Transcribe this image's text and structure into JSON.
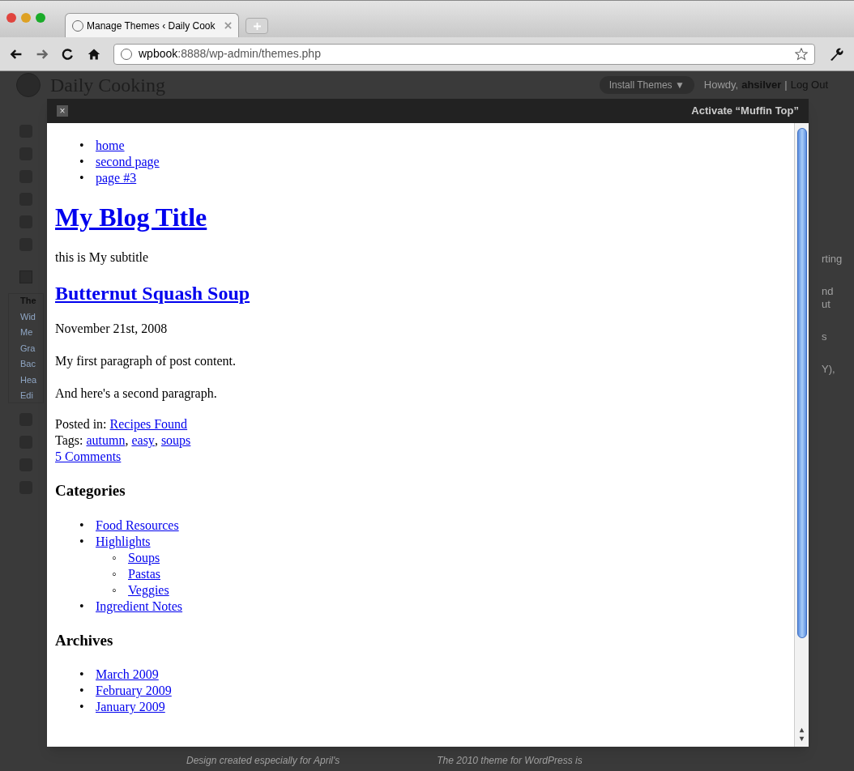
{
  "browser": {
    "tab_title": "Manage Themes ‹ Daily Cook",
    "url_host": "wpbook",
    "url_rest": ":8888/wp-admin/themes.php"
  },
  "admin": {
    "site_title": "Daily Cooking",
    "install_button": "Install Themes ▼",
    "howdy": "Howdy,",
    "user": "ahsilver",
    "separator": "|",
    "logout": "Log Out",
    "submenu": [
      {
        "label": "The",
        "selected": true
      },
      {
        "label": "Wid",
        "selected": false
      },
      {
        "label": "Me",
        "selected": false
      },
      {
        "label": "Gra",
        "selected": false
      },
      {
        "label": "Bac",
        "selected": false
      },
      {
        "label": "Hea",
        "selected": false
      },
      {
        "label": "Edi",
        "selected": false
      }
    ],
    "right_fragments": [
      "rting",
      "nd\nut",
      "s",
      "Y),"
    ],
    "bottom_descriptions": [
      "Design created especially for April's",
      "The 2010 theme for WordPress is"
    ]
  },
  "modal": {
    "title": "Activate “Muffin Top”",
    "close": "×",
    "bullet": "•",
    "sub_bullet": "◦",
    "tag_separator": ",",
    "nav": [
      "home",
      "second page",
      "page #3"
    ],
    "blog_title": "My Blog Title",
    "subtitle": "this is My subtitle",
    "post": {
      "title": "Butternut Squash Soup",
      "date": "November 21st, 2008",
      "paragraphs": [
        "My first paragraph of post content.",
        "And here's a second paragraph."
      ],
      "posted_in_label": "Posted in:",
      "category": "Recipes Found",
      "tags_label": "Tags:",
      "tags": [
        "autumn",
        "easy",
        "soups"
      ],
      "comments": "5 Comments"
    },
    "widgets": [
      {
        "title": "Categories",
        "items": [
          {
            "label": "Food Resources"
          },
          {
            "label": "Highlights",
            "children": [
              {
                "label": "Soups"
              },
              {
                "label": "Pastas"
              },
              {
                "label": "Veggies"
              }
            ]
          },
          {
            "label": "Ingredient Notes"
          }
        ]
      },
      {
        "title": "Archives",
        "items": [
          {
            "label": "March 2009"
          },
          {
            "label": "February 2009"
          },
          {
            "label": "January 2009"
          }
        ]
      }
    ]
  }
}
